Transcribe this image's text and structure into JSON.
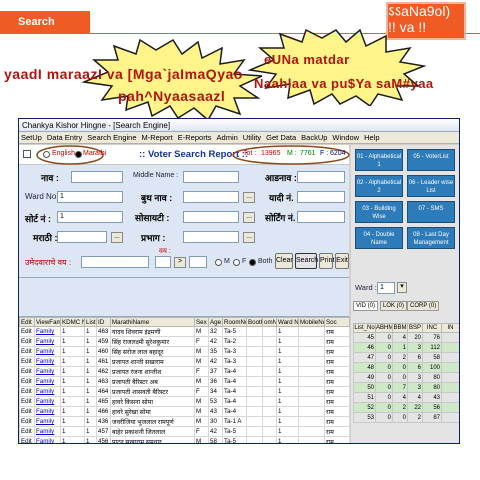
{
  "banner": {
    "title": "Search Engine",
    "corner_text": "ऽऽaNa9ol)\n!! va !!"
  },
  "callouts": {
    "left": "yaadI maraazI va [Mga`jaImaQyao",
    "left_line2": "pah^Nyaasaazl",
    "right_line1": "eUNa matdar",
    "right_line2": "Naahlaa va pu$Ya saM#yaa"
  },
  "window": {
    "title": "Chankya   Kishor Hingne - [Search Engine]",
    "menu": [
      "SetUp",
      "Data Entry",
      "Search Engine",
      "M-Report",
      "E-Reports",
      "Admin",
      "Utility",
      "Get Data",
      "BackUp",
      "Window",
      "Help"
    ]
  },
  "lang": {
    "english": "English",
    "marathi": "Marathi",
    "report_title": ":: Voter Search Report ::",
    "tot_label": "Tot :",
    "tot_value": "13965",
    "m_label": "M :",
    "m_value": "7761",
    "f_label": "F :",
    "f_value": "6204"
  },
  "form": {
    "name_label": "नाव :",
    "middle_name_label": "Middle Name :",
    "surname_label": "आडनाव :",
    "ward_label": "Ward No :",
    "ward_value": "1",
    "booth_label": "बुथ नाव :",
    "booth_no_label": "यादी नं. :",
    "list_no_label": "सोर्ट नं :",
    "list_no_value": "1",
    "society_label": "सोसायटी :",
    "sort_label": "सोर्टिंग नं. :",
    "marathi_label": "मराठी :",
    "area_label": "प्रभाग :",
    "age_label": "उमेदवाराचे वय :",
    "age_value": "",
    "from_label": "वय :",
    "gender": [
      "M",
      "F",
      "Both"
    ],
    "buttons": [
      "Clear",
      "Search",
      "Print",
      "Exit"
    ],
    "dots": "..."
  },
  "grid": {
    "headers": [
      "Edit",
      "ViewFamily",
      "KDMC No",
      "List",
      "ID",
      "MarathiName",
      "Sex",
      "Age",
      "RoomNo",
      "Booth",
      "omNo",
      "Ward No",
      "MobileNo",
      "Soc"
    ],
    "rows": [
      [
        "Edit",
        "Family",
        "1",
        "1",
        "463",
        "यादव शिवराम इंद्रमणी",
        "M",
        "32",
        "Ta-5",
        "",
        "",
        "1",
        "",
        "राम"
      ],
      [
        "Edit",
        "Family",
        "1",
        "1",
        "459",
        "सिंह राजलक्ष्मी सुरेशकुमार",
        "F",
        "42",
        "Ta-2",
        "",
        "",
        "1",
        "",
        "राम"
      ],
      [
        "Edit",
        "Family",
        "1",
        "1",
        "460",
        "सिंह सरोज लाल बहादूर",
        "M",
        "35",
        "Ta-3",
        "",
        "",
        "1",
        "",
        "राम"
      ],
      [
        "Edit",
        "Family",
        "1",
        "1",
        "461",
        "प्रजापत शान्ती सखाराम",
        "M",
        "42",
        "Ta-3",
        "",
        "",
        "1",
        "",
        "राम"
      ],
      [
        "Edit",
        "Family",
        "1",
        "1",
        "462",
        "प्रजापत रंजना शान्तीश",
        "F",
        "37",
        "Ta-4",
        "",
        "",
        "1",
        "",
        "राम"
      ],
      [
        "Edit",
        "Family",
        "1",
        "1",
        "463",
        "प्रजापती बैरिस्टर अब",
        "M",
        "36",
        "Ta-4",
        "",
        "",
        "1",
        "",
        "राम"
      ],
      [
        "Edit",
        "Family",
        "1",
        "1",
        "464",
        "प्रजापती शासवती बैरिस्टर",
        "F",
        "34",
        "Ta-4",
        "",
        "",
        "1",
        "",
        "राम"
      ],
      [
        "Edit",
        "Family",
        "1",
        "1",
        "465",
        "हावरे किसना सोमा",
        "M",
        "53",
        "Ta-4",
        "",
        "",
        "1",
        "",
        "राम"
      ],
      [
        "Edit",
        "Family",
        "1",
        "1",
        "466",
        "हावरे सुरेखा सोमा",
        "M",
        "43",
        "Ta-4",
        "",
        "",
        "1",
        "",
        "राम"
      ],
      [
        "Edit",
        "Family",
        "1",
        "1",
        "436",
        "जवरीजिया भुजलाल रामपूर्ण",
        "M",
        "30",
        "Ta-1 A",
        "",
        "",
        "1",
        "",
        "राम"
      ],
      [
        "Edit",
        "Family",
        "1",
        "1",
        "457",
        "बाहेर प्रकाशनी जितलाल",
        "F",
        "42",
        "Ta-5",
        "",
        "",
        "1",
        "",
        "राम"
      ],
      [
        "Edit",
        "Family",
        "1",
        "1",
        "456",
        "पाटन सखाराम समधार",
        "M",
        "58",
        "Ta-5",
        "",
        "",
        "1",
        "",
        "राम"
      ]
    ]
  },
  "right_panel": {
    "buttons": [
      [
        "01 - Alphabetical 1",
        "05 - VoterList"
      ],
      [
        "02 - Alphabetical 2",
        "06 - Leader wise List"
      ],
      [
        "03 - Building Wise",
        "07 - SMS"
      ],
      [
        "04 - Double Name",
        "08 - Last Day Management"
      ]
    ],
    "ward_label": "Ward :",
    "ward_value": "1",
    "tabs": [
      "VID (0)",
      "LOK (0)",
      "CORP (0)"
    ],
    "table_headers": [
      "List_No",
      "ABHM",
      "BBM",
      "BSP",
      "INC",
      "IN"
    ],
    "table_rows": [
      [
        "45",
        "0",
        "4",
        "20",
        "76",
        ""
      ],
      [
        "46",
        "0",
        "1",
        "3",
        "112",
        ""
      ],
      [
        "47",
        "0",
        "2",
        "6",
        "58",
        ""
      ],
      [
        "48",
        "0",
        "0",
        "6",
        "100",
        ""
      ],
      [
        "49",
        "0",
        "0",
        "3",
        "80",
        ""
      ],
      [
        "50",
        "0",
        "7",
        "3",
        "80",
        ""
      ],
      [
        "51",
        "0",
        "4",
        "4",
        "43",
        ""
      ],
      [
        "52",
        "0",
        "2",
        "22",
        "56",
        ""
      ],
      [
        "53",
        "0",
        "0",
        "2",
        "87",
        ""
      ]
    ]
  },
  "colors": {
    "brand": "#f05a24",
    "callout_text": "#b0140c",
    "grid_link": "#0000cc",
    "panel_btn": "#2e7bb9"
  }
}
